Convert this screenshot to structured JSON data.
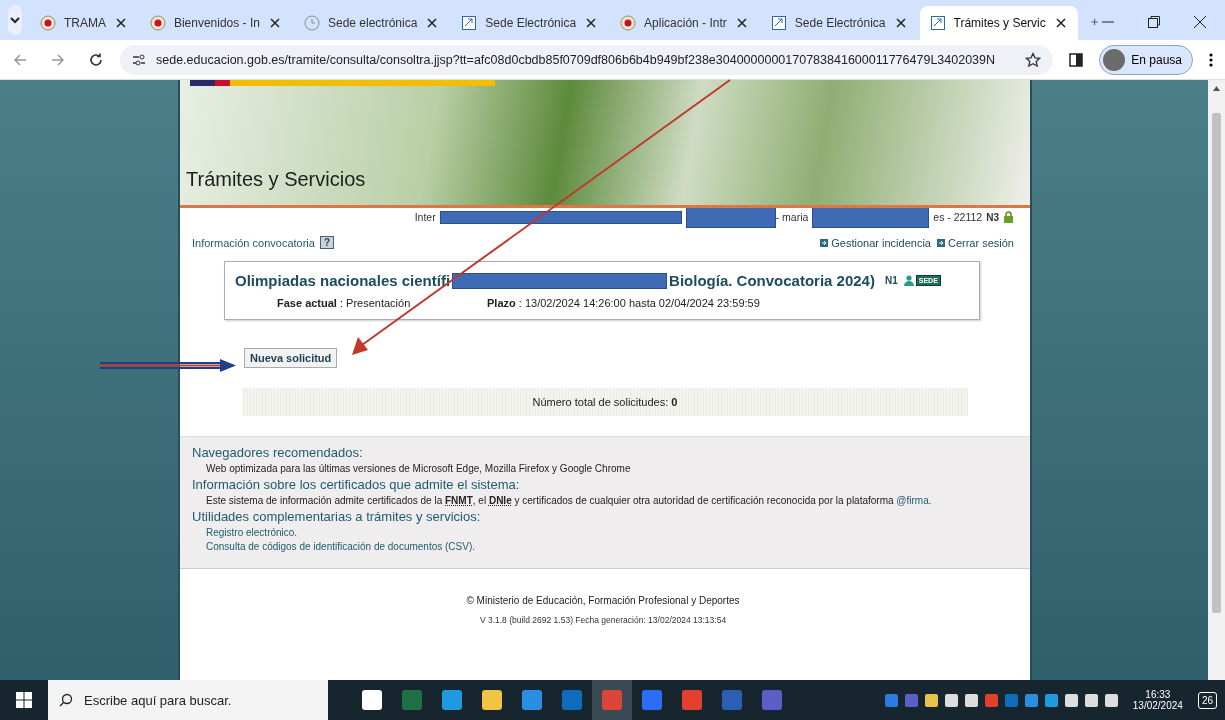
{
  "browser": {
    "tabs": [
      {
        "label": "TRAMA",
        "selected": false
      },
      {
        "label": "Bienvenidos - In",
        "selected": false
      },
      {
        "label": "Sede electrónica",
        "selected": false
      },
      {
        "label": "Sede Electrónica",
        "selected": false
      },
      {
        "label": "Aplicación - Intr",
        "selected": false
      },
      {
        "label": "Sede Electrónica",
        "selected": false
      },
      {
        "label": "Trámites y Servic",
        "selected": true
      }
    ],
    "url": "sede.educacion.gob.es/tramite/consulta/consoltra.jjsp?tt=afc08d0cbdb85f0709df806b6b4b949bf238e3040000000170783841600011776479L3402039N",
    "profile": "En pausa"
  },
  "page": {
    "header_title": "Trámites y Servicios",
    "user_line": [
      "Inter",
      "- maria",
      "es - 22112"
    ],
    "user_level": "N3",
    "info_link": "Información convocatoria",
    "help": "?",
    "actions": [
      "Gestionar incidencia",
      "Cerrar sesión"
    ],
    "convocatoria": {
      "title_start": "Olimpiadas nacionales científi",
      "title_end": "Biología. Convocatoria 2024)",
      "level": "N1",
      "badge": "SEDE",
      "fase_label": "Fase actual",
      "fase_value": ": Presentación",
      "plazo_label": "Plazo",
      "plazo_value": ": 13/02/2024 14:26:00 hasta 02/04/2024 23:59:59"
    },
    "new_button": "Nueva solicitud",
    "total_label": "Número total de solicitudes:",
    "total": "0",
    "info_sections": [
      {
        "heading": "Navegadores recomendados:",
        "items": [
          {
            "kind": "text",
            "text": "Web optimizada para las últimas versiones de Microsoft Edge, Mozilla Firefox y Google Chrome"
          }
        ]
      },
      {
        "heading": "Información sobre los certificados que admite el sistema:",
        "items": [
          {
            "kind": "text",
            "text": "Este sistema de información admite certificados de la **FNMT**, el **DNIe** y certificados de cualquier otra autoridad de certificación reconocida por la plataforma",
            "link": "@firma."
          }
        ]
      },
      {
        "heading": "Utilidades complementarias a trámites y servicios:",
        "items": [
          {
            "kind": "link",
            "text": "Registro electrónico."
          },
          {
            "kind": "link",
            "text": "Consulta de códigos de identificación de documentos (CSV)."
          }
        ]
      }
    ],
    "copyright": "© Ministerio de Educación, Formación Profesional y Deportes",
    "version": "V 3.1.8 (build 2692 1.53) Fecha generación: 13/02/2024 13:13:54"
  },
  "taskbar": {
    "search_placeholder": "Escribe aquí para buscar.",
    "apps": [
      {
        "kind": "taskview",
        "selected": false
      },
      {
        "kind": "excel",
        "selected": false
      },
      {
        "kind": "edge",
        "selected": false
      },
      {
        "kind": "folder",
        "selected": false
      },
      {
        "kind": "ie",
        "selected": false
      },
      {
        "kind": "outlook",
        "selected": false
      },
      {
        "kind": "chrome",
        "selected": true
      },
      {
        "kind": "zoom",
        "selected": false
      },
      {
        "kind": "hand",
        "selected": false
      },
      {
        "kind": "word",
        "selected": false
      },
      {
        "kind": "teams",
        "selected": false
      }
    ],
    "time": "16:33",
    "date": "13/02/2024",
    "notifications": "26"
  }
}
